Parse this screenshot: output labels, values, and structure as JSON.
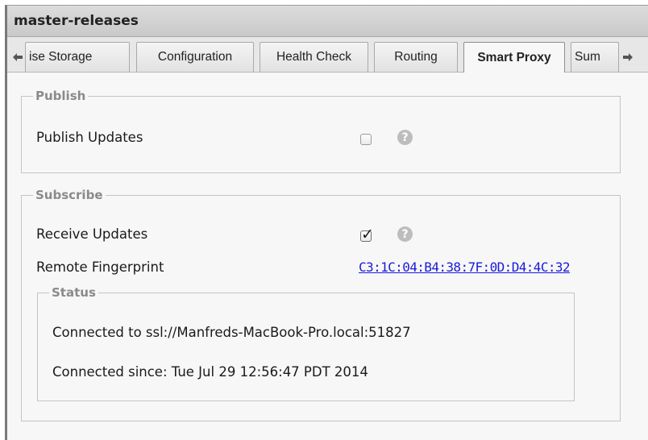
{
  "window": {
    "title": "master-releases"
  },
  "tabs": {
    "left_arrow_icon": "left-arrow",
    "right_arrow_icon": "right-arrow",
    "items": [
      {
        "label": "ise Storage",
        "active": false
      },
      {
        "label": "Configuration",
        "active": false
      },
      {
        "label": "Health Check",
        "active": false
      },
      {
        "label": "Routing",
        "active": false
      },
      {
        "label": "Smart Proxy",
        "active": true
      },
      {
        "label": "Sum",
        "active": false
      }
    ]
  },
  "publish": {
    "legend": "Publish",
    "updates_label": "Publish Updates",
    "updates_checked": false,
    "help_glyph": "?"
  },
  "subscribe": {
    "legend": "Subscribe",
    "updates_label": "Receive Updates",
    "updates_checked": true,
    "help_glyph": "?",
    "fingerprint_label": "Remote Fingerprint",
    "fingerprint_value": "C3:1C:04:B4:38:7F:0D:D4:4C:32"
  },
  "status": {
    "legend": "Status",
    "connected_to": "Connected to ssl://Manfreds-MacBook-Pro.local:51827",
    "connected_since": "Connected since: Tue Jul 29 12:56:47 PDT 2014"
  }
}
